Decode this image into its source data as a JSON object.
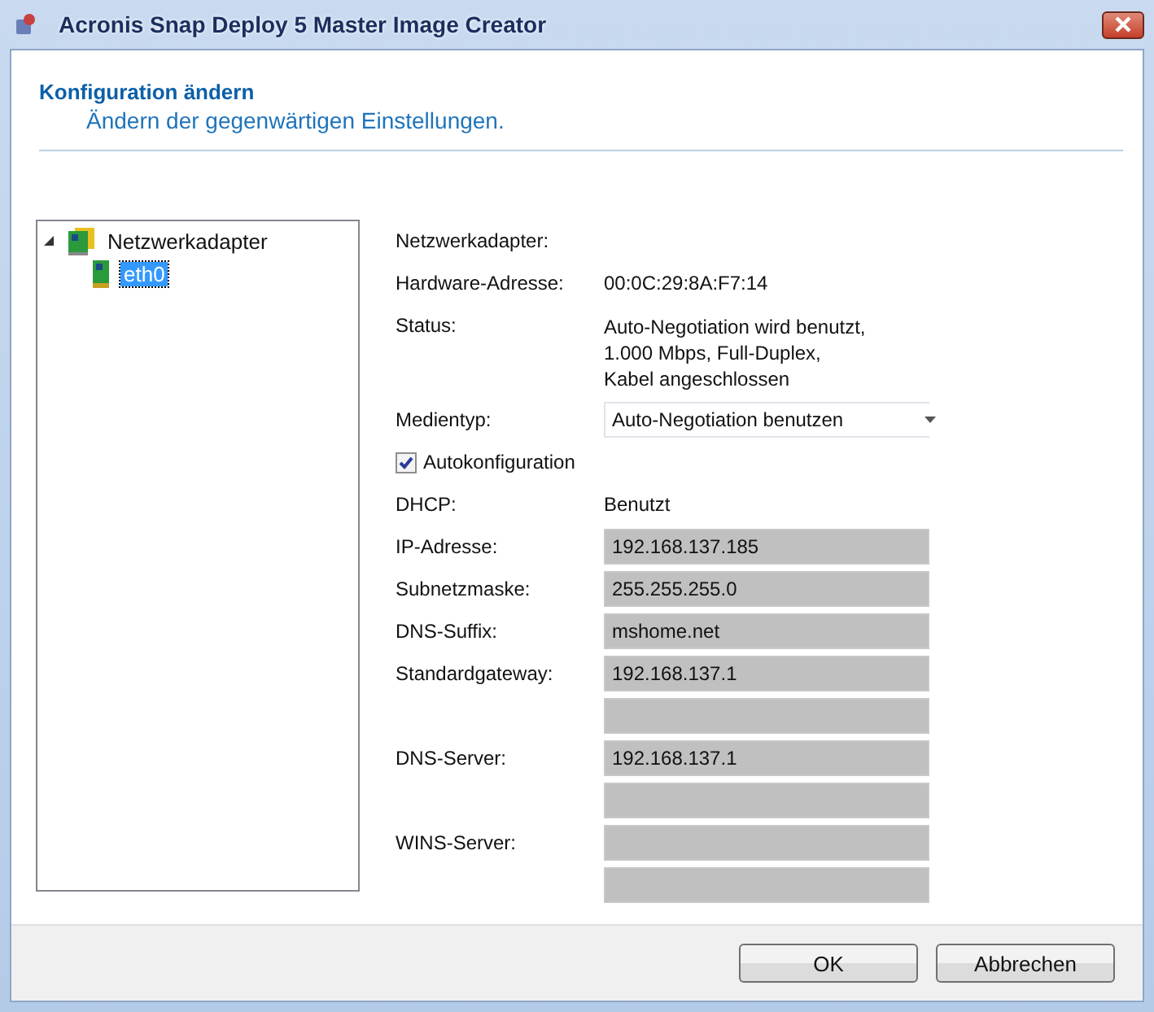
{
  "window": {
    "title": "Acronis Snap Deploy 5 Master Image Creator"
  },
  "header": {
    "title": "Konfiguration ändern",
    "subtitle": "Ändern der gegenwärtigen Einstellungen."
  },
  "tree": {
    "items": [
      {
        "label": "Netzwerkadapter",
        "expanded": true,
        "selected": false,
        "children": [
          {
            "label": "eth0",
            "selected": true
          }
        ]
      }
    ]
  },
  "details": [
    {
      "kind": "heading",
      "label": "Netzwerkadapter:"
    },
    {
      "kind": "text",
      "label": "Hardware-Adresse:",
      "value": "00:0C:29:8A:F7:14"
    },
    {
      "kind": "multiline",
      "label": "Status:",
      "lines": [
        "Auto-Negotiation wird benutzt,",
        "1.000 Mbps, Full-Duplex,",
        "Kabel angeschlossen"
      ]
    },
    {
      "kind": "select",
      "label": "Medientyp:",
      "value": "Auto-Negotiation benutzen"
    },
    {
      "kind": "checkbox",
      "label": "Autokonfiguration",
      "checked": true
    },
    {
      "kind": "text",
      "label": "DHCP:",
      "value": "Benutzt"
    },
    {
      "kind": "field",
      "label": "IP-Adresse:",
      "value": "192.168.137.185",
      "disabled": true
    },
    {
      "kind": "field",
      "label": "Subnetzmaske:",
      "value": "255.255.255.0",
      "disabled": true
    },
    {
      "kind": "field",
      "label": "DNS-Suffix:",
      "value": "mshome.net",
      "disabled": true
    },
    {
      "kind": "field",
      "label": "Standardgateway:",
      "value": "192.168.137.1",
      "disabled": true
    },
    {
      "kind": "field",
      "disabled": true
    },
    {
      "kind": "field",
      "label": "DNS-Server:",
      "value": "192.168.137.1",
      "disabled": true
    },
    {
      "kind": "field",
      "disabled": true
    },
    {
      "kind": "field",
      "label": "WINS-Server:",
      "disabled": true
    },
    {
      "kind": "field",
      "disabled": true
    }
  ],
  "buttons": [
    {
      "label": "OK"
    },
    {
      "label": "Abbrechen"
    }
  ]
}
